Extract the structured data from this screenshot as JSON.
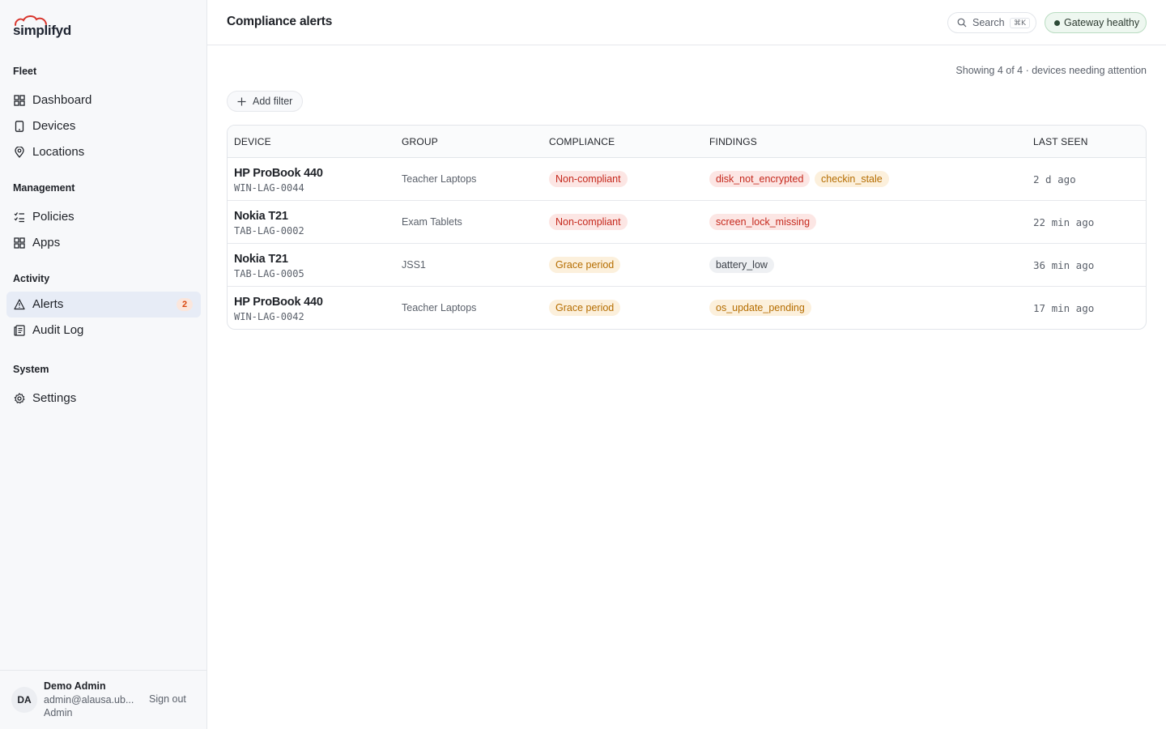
{
  "brand": {
    "name": "simplifyd"
  },
  "sidebar": {
    "sections": [
      {
        "heading": "Fleet",
        "items": [
          {
            "label": "Dashboard",
            "icon": "grid-icon"
          },
          {
            "label": "Devices",
            "icon": "tablet-icon"
          },
          {
            "label": "Locations",
            "icon": "map-pin-icon"
          }
        ]
      },
      {
        "heading": "Management",
        "items": [
          {
            "label": "Policies",
            "icon": "checklist-icon"
          },
          {
            "label": "Apps",
            "icon": "apps-icon"
          }
        ]
      },
      {
        "heading": "Activity",
        "items": [
          {
            "label": "Alerts",
            "icon": "alert-triangle-icon",
            "badge": "2",
            "active": true
          },
          {
            "label": "Audit Log",
            "icon": "log-icon"
          }
        ]
      },
      {
        "heading": "System",
        "items": [
          {
            "label": "Settings",
            "icon": "gear-icon"
          }
        ]
      }
    ]
  },
  "user": {
    "initials": "DA",
    "name": "Demo Admin",
    "email": "admin@alausa.ub...",
    "role": "Admin",
    "signout_label": "Sign out"
  },
  "topbar": {
    "title": "Compliance alerts",
    "search_label": "Search",
    "search_shortcut": "⌘K",
    "gateway_status": "Gateway healthy"
  },
  "toolbar": {
    "showing_text": "Showing 4 of 4 · devices needing attention",
    "add_filter_label": "Add filter"
  },
  "table": {
    "columns": [
      "DEVICE",
      "GROUP",
      "COMPLIANCE",
      "FINDINGS",
      "LAST SEEN"
    ],
    "rows": [
      {
        "name": "HP ProBook 440",
        "id": "WIN-LAG-0044",
        "group": "Teacher Laptops",
        "compliance": "Non-compliant",
        "compliance_level": "red",
        "findings": [
          {
            "text": "disk_not_encrypted",
            "level": "red"
          },
          {
            "text": "checkin_stale",
            "level": "amber"
          }
        ],
        "last_seen": "2 d ago"
      },
      {
        "name": "Nokia T21",
        "id": "TAB-LAG-0002",
        "group": "Exam Tablets",
        "compliance": "Non-compliant",
        "compliance_level": "red",
        "findings": [
          {
            "text": "screen_lock_missing",
            "level": "red"
          }
        ],
        "last_seen": "22 min ago"
      },
      {
        "name": "Nokia T21",
        "id": "TAB-LAG-0005",
        "group": "JSS1",
        "compliance": "Grace period",
        "compliance_level": "amber",
        "findings": [
          {
            "text": "battery_low",
            "level": "gray"
          }
        ],
        "last_seen": "36 min ago"
      },
      {
        "name": "HP ProBook 440",
        "id": "WIN-LAG-0042",
        "group": "Teacher Laptops",
        "compliance": "Grace period",
        "compliance_level": "amber",
        "findings": [
          {
            "text": "os_update_pending",
            "level": "amber"
          }
        ],
        "last_seen": "17 min ago"
      }
    ]
  },
  "colors": {
    "red_text": "#c5281c",
    "red_bg": "#fce6e4",
    "amber_text": "#b56d00",
    "amber_bg": "#fcf0dc",
    "active_nav_bg": "#e7ecf6",
    "badge_text": "#d9480f"
  }
}
